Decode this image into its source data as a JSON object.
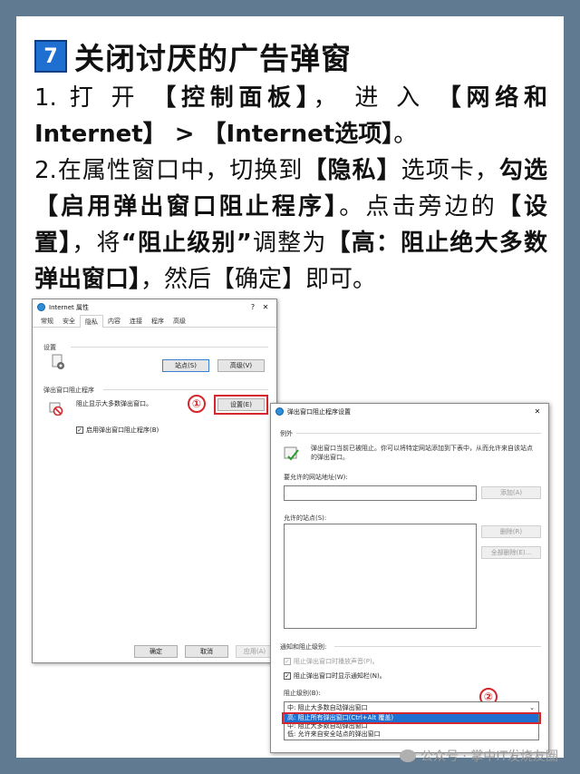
{
  "heading": {
    "number": "7",
    "title": "关闭讨厌的广告弹窗"
  },
  "instructions": {
    "step1": {
      "prefix": "1. 打 开 ",
      "control_panel": "【控制面板】",
      "middle": "， 进 入 ",
      "network": "【网络和Internet】",
      "arrow": " > ",
      "options": "【Internet选项】",
      "suffix": "。"
    },
    "step2": {
      "prefix": "2.在属性窗口中，切换到",
      "privacy": "【隐私】",
      "middle1": "选项卡，",
      "check_word": "勾选",
      "enable_popup": "【启用弹出窗口阻止程序】",
      "middle2": "。点击旁边的",
      "settings": "【设置】",
      "middle3": "，将",
      "level_quote": "“阻止级别”",
      "middle4": "调整为",
      "high_level": "【高：阻止绝大多数弹出窗口】",
      "middle5": "，然后【确定】即可。"
    }
  },
  "dialog1": {
    "title": "Internet 属性",
    "help": "?",
    "close": "✕",
    "tabs": [
      "常规",
      "安全",
      "隐私",
      "内容",
      "连接",
      "程序",
      "高级"
    ],
    "active_tab": "隐私",
    "settings_group": "设置",
    "sites_button": "站点(S)",
    "advanced_button": "高级(V)",
    "popup_group": "弹出窗口阻止程序",
    "popup_desc": "阻止显示大多数弹出窗口。",
    "settings_button": "设置(E)",
    "enable_checkbox": "启用弹出窗口阻止程序(B)",
    "annotation": "①",
    "ok_button": "确定",
    "cancel_button": "取消",
    "apply_button": "应用(A)"
  },
  "dialog2": {
    "title": "弹出窗口阻止程序设置",
    "close": "✕",
    "exceptions_label": "例外",
    "exceptions_desc": "弹出窗口当前已被阻止。你可以将特定网站添加到下表中，从而允许来自该站点的弹出窗口。",
    "allowed_address_label": "要允许的网站地址(W):",
    "add_button": "添加(A)",
    "allowed_sites_label": "允许的站点(S):",
    "remove_button": "删除(R)",
    "remove_all_button": "全部删除(E)...",
    "notify_group": "通知和阻止级别:",
    "play_sound": "阻止弹出窗口时播放声音(P)。",
    "show_bar": "阻止弹出窗口时显示通知栏(N)。",
    "level_label": "阻止级别(B):",
    "level_selected": "中: 阻止大多数自动弹出窗口",
    "level_options": [
      "高: 阻止所有弹出窗口(Ctrl+Alt 覆盖)",
      "中: 阻止大多数自动弹出窗口",
      "低: 允许来自安全站点的弹出窗口"
    ],
    "annotation": "②"
  },
  "watermark": "公众号 · 掌中IT发烧友圈",
  "colors": {
    "accent_blue": "#1f6fd0",
    "annotation_red": "#d4262c",
    "frame": "#5f7a91"
  }
}
